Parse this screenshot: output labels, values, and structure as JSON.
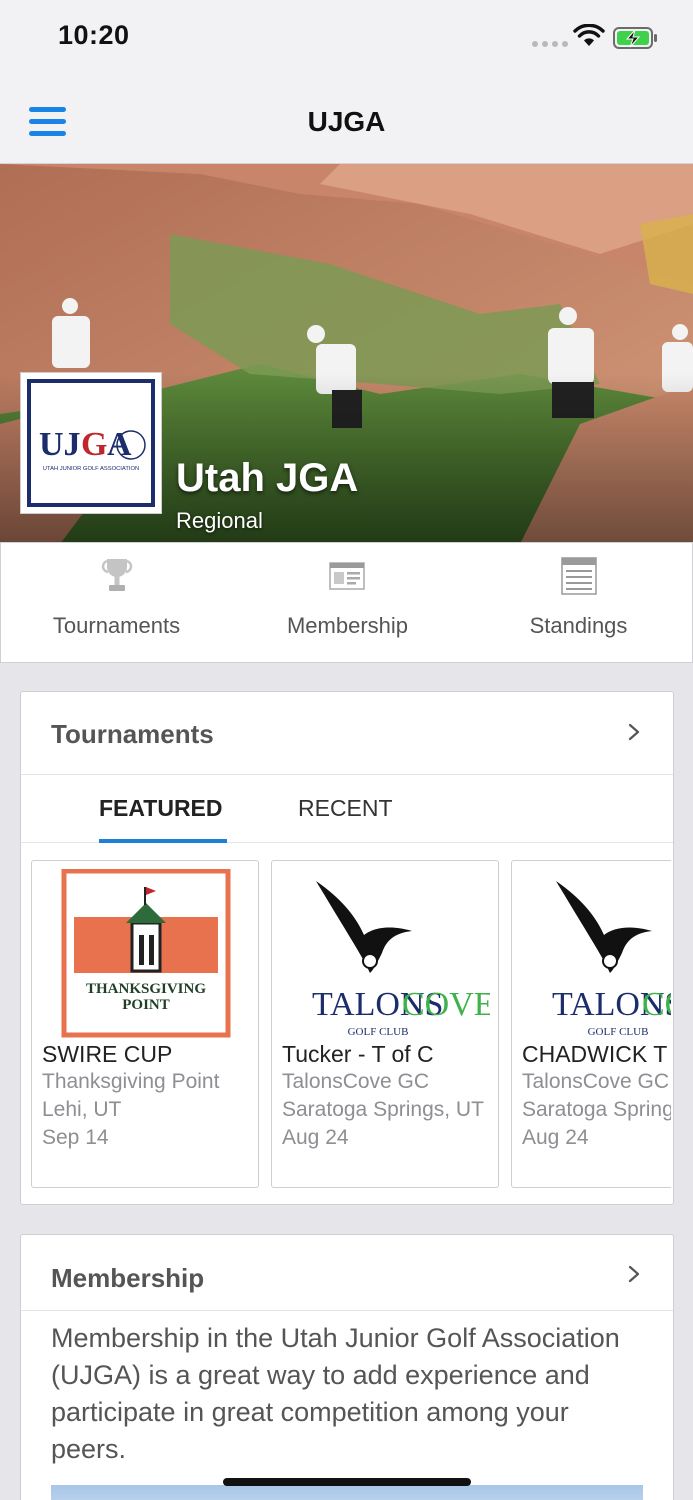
{
  "status_bar": {
    "time": "10:20"
  },
  "nav": {
    "title": "UJGA"
  },
  "org": {
    "name": "Utah JGA",
    "type": "Regional",
    "logo_text": "UJGA",
    "logo_subtext": "UTAH JUNIOR GOLF ASSOCIATION"
  },
  "quicklinks": [
    {
      "label": "Tournaments",
      "icon": "trophy-icon"
    },
    {
      "label": "Membership",
      "icon": "membership-card-icon"
    },
    {
      "label": "Standings",
      "icon": "standings-icon"
    }
  ],
  "tournaments_card": {
    "title": "Tournaments",
    "tabs": [
      {
        "label": "FEATURED",
        "active": true
      },
      {
        "label": "RECENT",
        "active": false
      }
    ],
    "items": [
      {
        "name": "SWIRE CUP",
        "venue": "Thanksgiving Point",
        "location": "Lehi, UT",
        "date": "Sep 14",
        "logo": "thanksgiving-point-logo",
        "logo_text": "THANKSGIVING POINT"
      },
      {
        "name": "Tucker - T of C",
        "venue": "TalonsCove GC",
        "location": "Saratoga Springs, UT",
        "date": "Aug 24",
        "logo": "talonscove-logo",
        "logo_text": "TALONSCOVE",
        "logo_subtext": "GOLF CLUB"
      },
      {
        "name": "CHADWICK T",
        "venue": "TalonsCove GC",
        "location": "Saratoga Springs, UT",
        "date": "Aug 24",
        "logo": "talonscove-logo",
        "logo_text": "TALONSCOVE",
        "logo_subtext": "GOLF CLUB"
      }
    ]
  },
  "membership_card": {
    "title": "Membership",
    "text": "Membership in the Utah Junior Golf Association (UJGA) is a great way to add experience and participate in great competition among your peers."
  },
  "colors": {
    "accent": "#1a84e6",
    "tab_underline": "#1e7fd6",
    "thanksgiving_frame": "#e8714e",
    "talons_blue": "#1b2e6b",
    "talons_green": "#3db34a"
  }
}
